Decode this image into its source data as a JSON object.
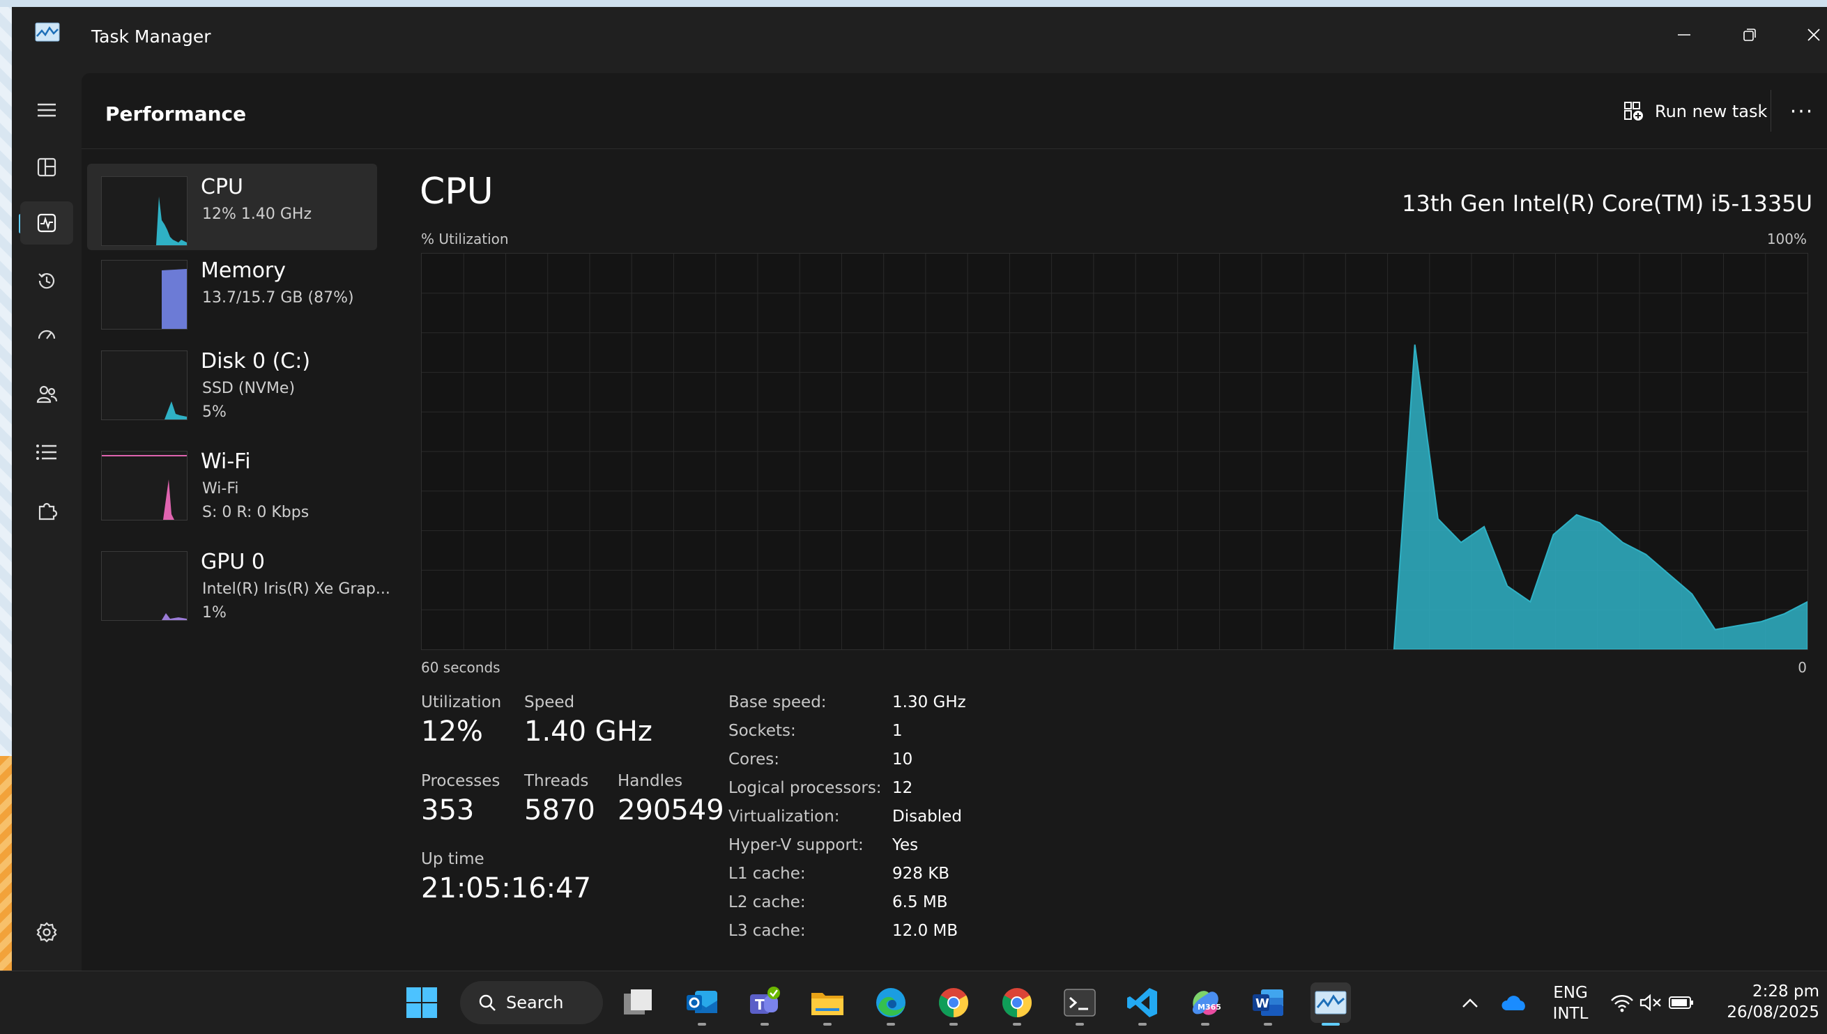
{
  "window": {
    "title": "Task Manager"
  },
  "page": {
    "title": "Performance"
  },
  "header": {
    "run_task_label": "Run new task",
    "more_label": "···"
  },
  "resources": [
    {
      "name": "CPU",
      "line1": "12%  1.40 GHz",
      "line2": "",
      "color": "#2fb1c5"
    },
    {
      "name": "Memory",
      "line1": "13.7/15.7 GB (87%)",
      "line2": "",
      "color": "#6c7bd6"
    },
    {
      "name": "Disk 0 (C:)",
      "line1": "SSD (NVMe)",
      "line2": "5%",
      "color": "#2fb1c5"
    },
    {
      "name": "Wi-Fi",
      "line1": "Wi-Fi",
      "line2": "S: 0  R: 0 Kbps",
      "color": "#e064b0"
    },
    {
      "name": "GPU 0",
      "line1": "Intel(R) Iris(R) Xe Grap...",
      "line2": "1%",
      "color": "#9a7bd6"
    }
  ],
  "detail": {
    "title": "CPU",
    "model": "13th Gen Intel(R) Core(TM) i5-1335U",
    "y_label": "% Utilization",
    "y_max_label": "100%",
    "x_left_label": "60 seconds",
    "x_right_label": "0"
  },
  "chart_data": {
    "type": "area",
    "title": "CPU",
    "ylabel": "% Utilization",
    "xlabel": "60 seconds",
    "ylim": [
      0,
      100
    ],
    "xlim": [
      60,
      0
    ],
    "x": [
      60,
      59,
      58,
      57,
      56,
      55,
      54,
      53,
      52,
      51,
      50,
      49,
      48,
      47,
      46,
      45,
      44,
      43,
      42,
      41,
      40,
      39,
      38,
      37,
      36,
      35,
      34,
      33,
      32,
      31,
      30,
      29,
      28,
      27,
      26,
      25,
      24,
      23,
      22,
      21,
      20,
      19,
      18,
      17,
      16,
      15,
      14,
      13,
      12,
      11,
      10,
      9,
      8,
      7,
      6,
      5,
      4,
      3,
      2,
      1,
      0
    ],
    "series": [
      {
        "values": [
          0,
          0,
          0,
          0,
          0,
          0,
          0,
          0,
          0,
          0,
          0,
          0,
          0,
          0,
          0,
          0,
          0,
          0,
          0,
          0,
          0,
          0,
          0,
          0,
          0,
          0,
          0,
          0,
          0,
          0,
          0,
          0,
          0,
          0,
          0,
          0,
          0,
          0,
          0,
          0,
          0,
          0,
          0,
          77,
          33,
          27,
          31,
          16,
          12,
          29,
          34,
          32,
          27,
          24,
          19,
          14,
          5,
          6,
          7,
          12
        ],
        "x_start": 43,
        "x_end": 0,
        "points": [
          [
            17.9,
            0
          ],
          [
            17.0,
            77
          ],
          [
            16.0,
            33
          ],
          [
            15.0,
            27
          ],
          [
            14.0,
            31
          ],
          [
            13.0,
            16
          ],
          [
            12.0,
            12
          ],
          [
            11.0,
            29
          ],
          [
            10.0,
            34
          ],
          [
            9.0,
            32
          ],
          [
            8.0,
            27
          ],
          [
            7.0,
            24
          ],
          [
            6.0,
            19
          ],
          [
            5.0,
            14
          ],
          [
            4.0,
            5
          ],
          [
            3.0,
            6
          ],
          [
            2.0,
            7
          ],
          [
            1.0,
            9
          ],
          [
            0,
            12
          ]
        ]
      }
    ],
    "grid": true,
    "color": "#2fb1c5"
  },
  "stats": {
    "utilization": {
      "label": "Utilization",
      "value": "12%"
    },
    "speed": {
      "label": "Speed",
      "value": "1.40 GHz"
    },
    "processes": {
      "label": "Processes",
      "value": "353"
    },
    "threads": {
      "label": "Threads",
      "value": "5870"
    },
    "handles": {
      "label": "Handles",
      "value": "290549"
    },
    "uptime": {
      "label": "Up time",
      "value": "21:05:16:47"
    }
  },
  "specs": [
    {
      "label": "Base speed:",
      "value": "1.30 GHz"
    },
    {
      "label": "Sockets:",
      "value": "1"
    },
    {
      "label": "Cores:",
      "value": "10"
    },
    {
      "label": "Logical processors:",
      "value": "12"
    },
    {
      "label": "Virtualization:",
      "value": "Disabled"
    },
    {
      "label": "Hyper-V support:",
      "value": "Yes"
    },
    {
      "label": "L1 cache:",
      "value": "928 KB"
    },
    {
      "label": "L2 cache:",
      "value": "6.5 MB"
    },
    {
      "label": "L3 cache:",
      "value": "12.0 MB"
    }
  ],
  "taskbar": {
    "search_label": "Search",
    "lang_1": "ENG",
    "lang_2": "INTL",
    "time": "2:28 pm",
    "date": "26/08/2025"
  }
}
